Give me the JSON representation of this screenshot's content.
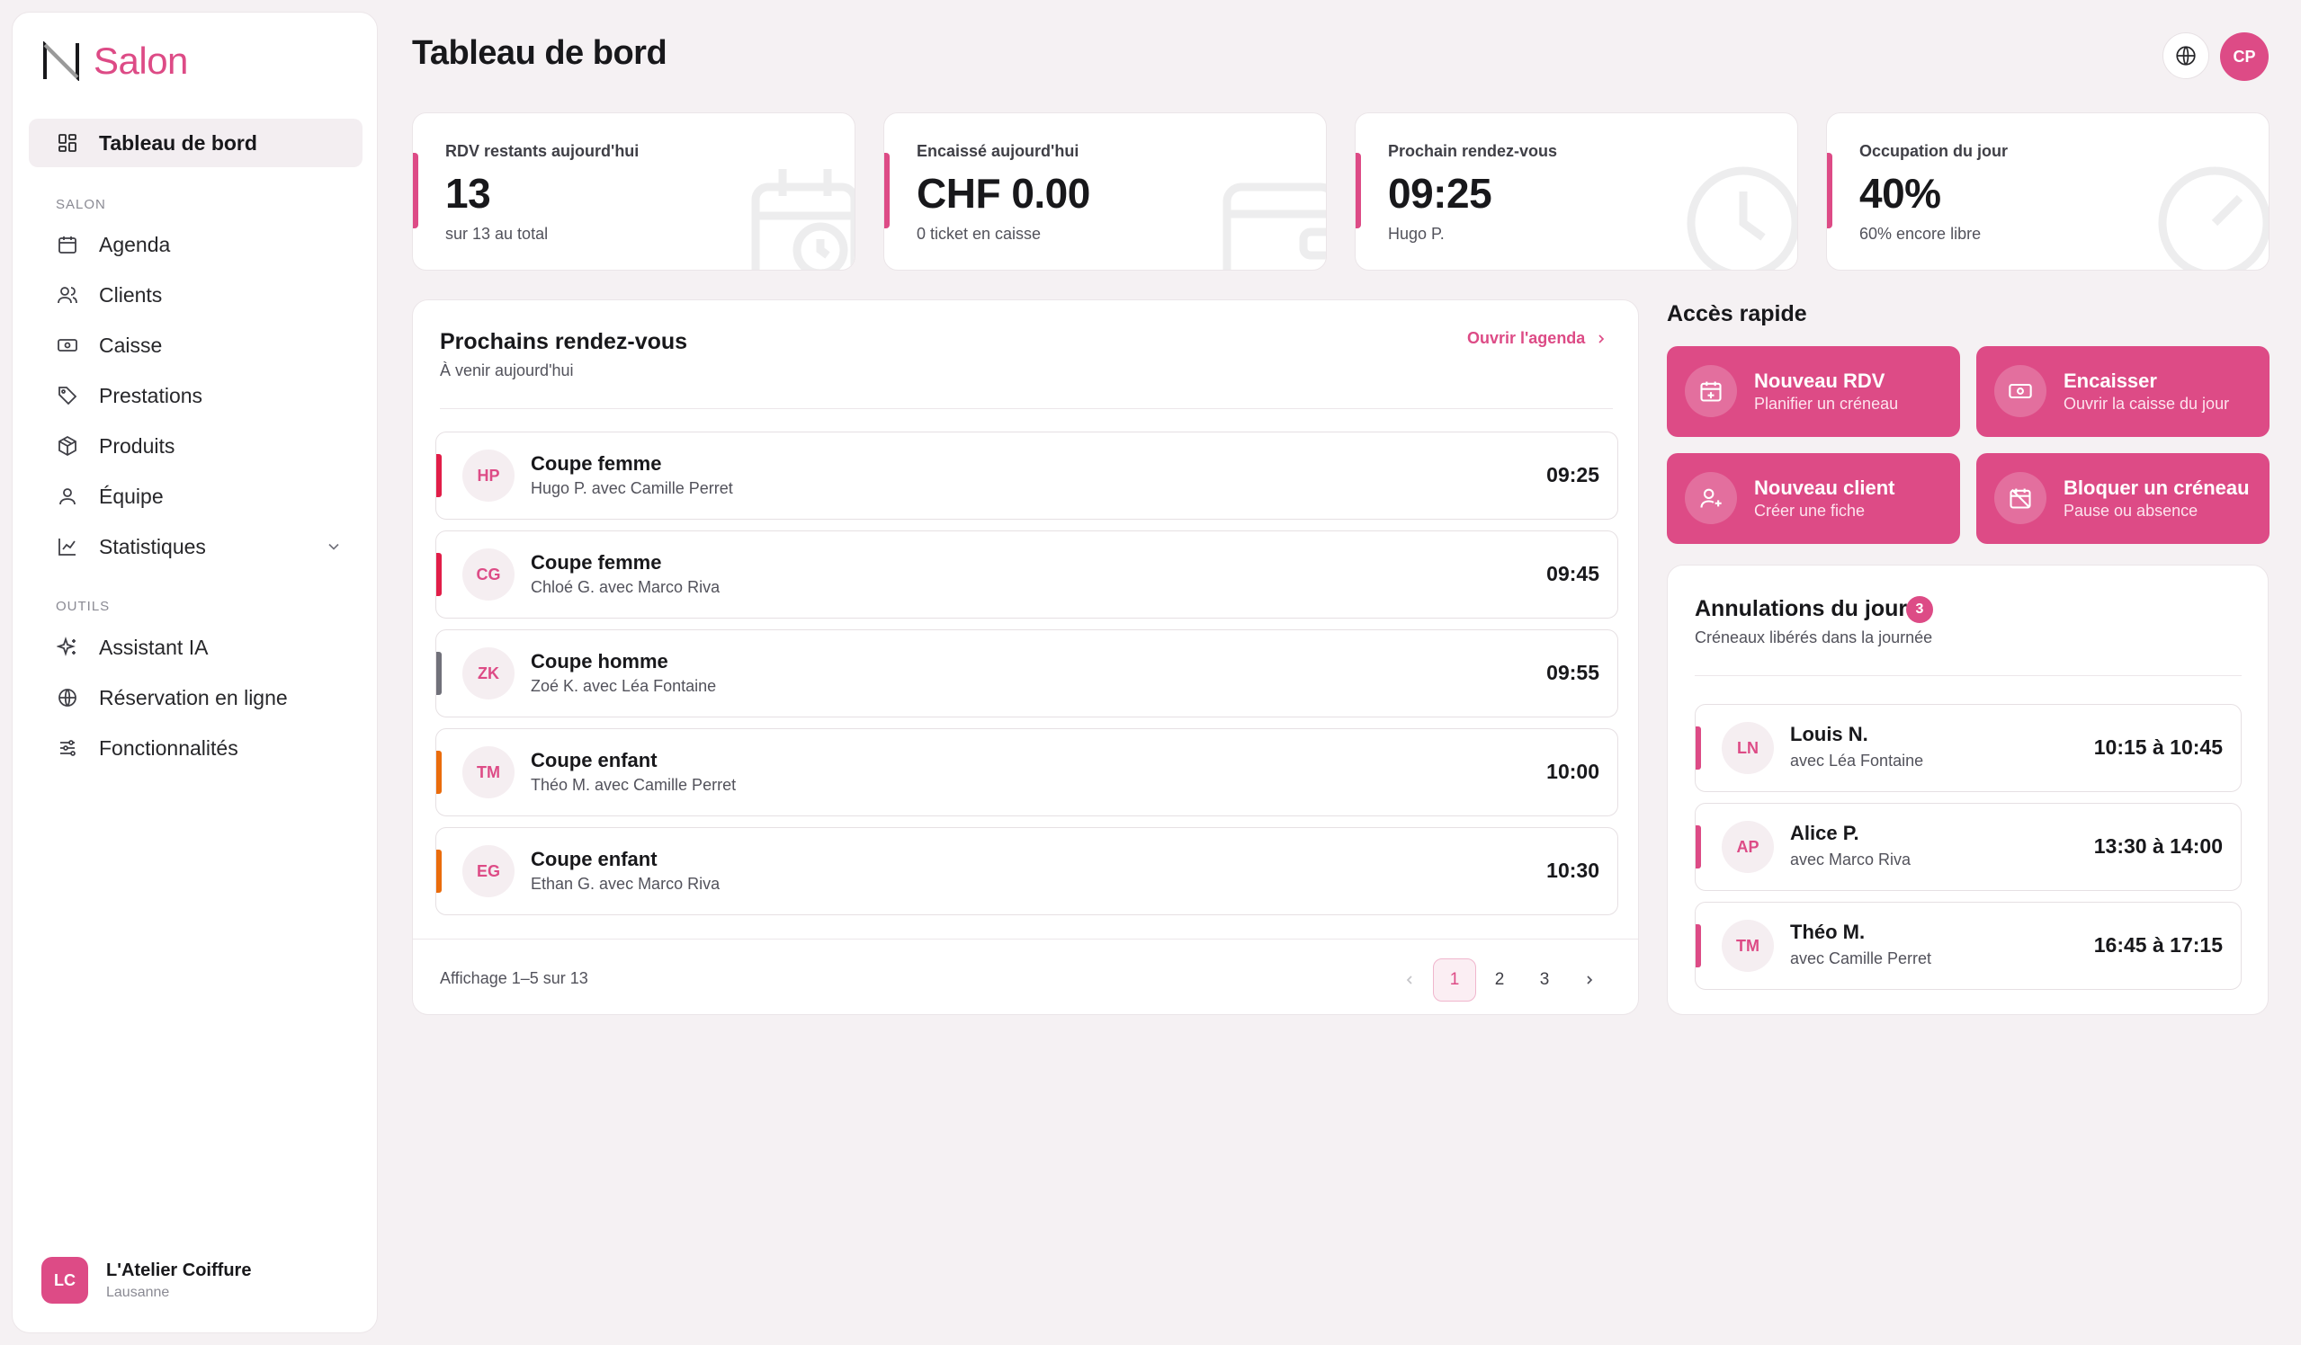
{
  "sidebar": {
    "brand": "Salon",
    "items": [
      {
        "label": "Tableau de bord",
        "icon": "grid-icon",
        "active": true
      },
      {
        "label": "Agenda",
        "icon": "calendar-icon"
      },
      {
        "label": "Clients",
        "icon": "users-icon"
      },
      {
        "label": "Caisse",
        "icon": "cash-icon"
      },
      {
        "label": "Prestations",
        "icon": "tag-icon"
      },
      {
        "label": "Produits",
        "icon": "box-icon"
      },
      {
        "label": "Équipe",
        "icon": "team-icon"
      },
      {
        "label": "Statistiques",
        "icon": "chart-line-icon"
      },
      {
        "label": "Assistant IA",
        "icon": "sparkles-icon"
      },
      {
        "label": "Réservation en ligne",
        "icon": "globe-icon"
      },
      {
        "label": "Fonctionnalités",
        "icon": "sliders-icon"
      }
    ],
    "sections": {
      "salon": "SALON",
      "outils": "OUTILS"
    },
    "footer": {
      "initials": "LC",
      "name": "L'Atelier Coiffure",
      "city": "Lausanne"
    }
  },
  "header": {
    "title": "Tableau de bord",
    "user_initials": "CP"
  },
  "stats": [
    {
      "label": "RDV restants aujourd'hui",
      "value": "13",
      "sub": "sur 13 au total"
    },
    {
      "label": "Encaissé aujourd'hui",
      "value": "CHF 0.00",
      "sub": "0 ticket en caisse"
    },
    {
      "label": "Prochain rendez-vous",
      "value": "09:25",
      "sub": "Hugo P."
    },
    {
      "label": "Occupation du jour",
      "value": "40%",
      "sub": "60% encore libre"
    }
  ],
  "upcoming": {
    "title": "Prochains rendez-vous",
    "subtitle": "À venir aujourd'hui",
    "link": "Ouvrir l'agenda",
    "items": [
      {
        "initials": "HP",
        "service": "Coupe femme",
        "detail": "Hugo P. avec Camille Perret",
        "time": "09:25",
        "color": "#e11d48"
      },
      {
        "initials": "CG",
        "service": "Coupe femme",
        "detail": "Chloé G. avec Marco Riva",
        "time": "09:45",
        "color": "#e11d48"
      },
      {
        "initials": "ZK",
        "service": "Coupe homme",
        "detail": "Zoé K. avec Léa Fontaine",
        "time": "09:55",
        "color": "#71717a"
      },
      {
        "initials": "TM",
        "service": "Coupe enfant",
        "detail": "Théo M. avec Camille Perret",
        "time": "10:00",
        "color": "#ea6c0c"
      },
      {
        "initials": "EG",
        "service": "Coupe enfant",
        "detail": "Ethan G. avec Marco Riva",
        "time": "10:30",
        "color": "#ea6c0c"
      }
    ],
    "pager": {
      "info": "Affichage 1–5 sur 13",
      "pages": [
        "1",
        "2",
        "3"
      ],
      "current": "1"
    }
  },
  "quick_access": {
    "title": "Accès rapide",
    "items": [
      {
        "title": "Nouveau RDV",
        "sub": "Planifier un créneau",
        "icon": "calendar-plus-icon"
      },
      {
        "title": "Encaisser",
        "sub": "Ouvrir la caisse du jour",
        "icon": "cash-icon"
      },
      {
        "title": "Nouveau client",
        "sub": "Créer une fiche",
        "icon": "user-plus-icon"
      },
      {
        "title": "Bloquer un créneau",
        "sub": "Pause ou absence",
        "icon": "calendar-off-icon"
      }
    ]
  },
  "cancellations": {
    "title": "Annulations du jour",
    "count": "3",
    "subtitle": "Créneaux libérés dans la journée",
    "items": [
      {
        "initials": "LN",
        "name": "Louis N.",
        "detail": "avec Léa Fontaine",
        "time": "10:15 à 10:45"
      },
      {
        "initials": "AP",
        "name": "Alice P.",
        "detail": "avec Marco Riva",
        "time": "13:30 à 14:00"
      },
      {
        "initials": "TM",
        "name": "Théo M.",
        "detail": "avec Camille Perret",
        "time": "16:45 à 17:15"
      }
    ]
  },
  "colors": {
    "accent": "#dd4b86",
    "background": "#f5f1f3"
  }
}
